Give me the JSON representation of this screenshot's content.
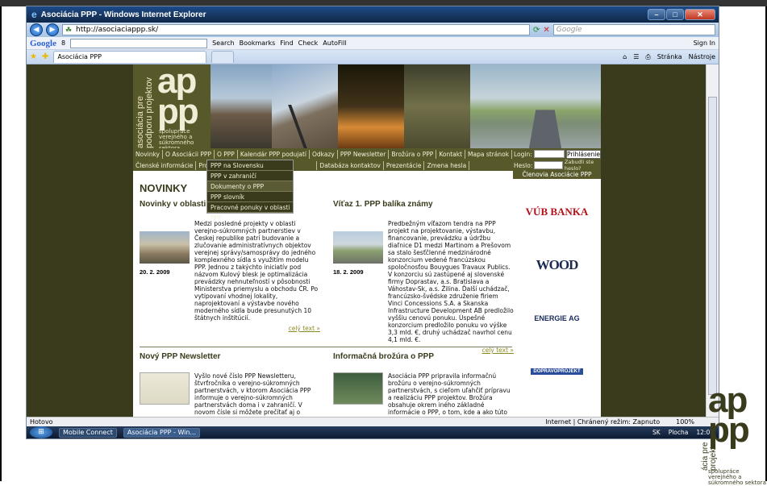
{
  "window": {
    "title": "Asociácia PPP - Windows Internet Explorer"
  },
  "address": {
    "url": "http://asociaciappp.sk/",
    "search_placeholder": "Google"
  },
  "googlebar": {
    "logo": "Google",
    "label": "8",
    "items": [
      "Search",
      "Bookmarks",
      "Find",
      "Check",
      "AutoFill",
      "Sign In"
    ]
  },
  "tabs": {
    "active": "Asociácia PPP"
  },
  "ie_tools": {
    "page": "Stránka",
    "tools": "Nástroje"
  },
  "logo": {
    "vertical": "asociácia pre podporu projektov",
    "big": "ap pp",
    "small": "spolupráce verejného a súkromného sektora"
  },
  "menu1": [
    "Novinky",
    "O Asociácii PPP",
    "O PPP",
    "Kalendár PPP podujatí",
    "Odkazy",
    "PPP Newsletter",
    "Brožúra o PPP",
    "Kontakt",
    "Mapa stránok"
  ],
  "menu2": [
    "Členské informácie",
    "Projekty",
    "Databáza kontaktov",
    "Prezentácie",
    "Zmena hesla"
  ],
  "dropdown": [
    "PPP na Slovensku",
    "PPP v zahraničí",
    "Dokumenty o PPP",
    "PPP slovník",
    "Pracovné ponuky v oblasti PPP"
  ],
  "login": {
    "login_label": "Login:",
    "password_label": "Heslo:",
    "button": "Prihlásenie",
    "forgot": "Zabudli ste heslo?"
  },
  "members_title": "Členovia Asociácie PPP",
  "heading": "NOVINKY",
  "article1": {
    "title": "Novinky v oblasti čes...",
    "date": "20. 2. 2009",
    "body": "Medzi posledné projekty v oblasti verejno-súkromných partnerstiev v Českej republike patrí budovanie a zlučovanie administratívnych objektov verejnej správy/samosprávy do jedného komplexného sídla s využitím modelu PPP. Jednou z takýchto iniciatív pod názvom Kulový blesk je optimalizácia prevádzky nehnuteľností v pôsobnosti Ministerstva priemyslu a obchodu ČR. Po vytipovaní vhodnej lokality, naprojektovaní a výstavbe nového moderného sídla bude presunutých 10 štátnych inštitúcií.",
    "more": "celý text »"
  },
  "article2": {
    "title": "Víťaz 1. PPP balíka známy",
    "date": "18. 2. 2009",
    "body": "Predbežným víťazom tendra na PPP projekt na projektovanie, výstavbu, financovanie, prevádzku a údržbu diaľnice D1 medzi Martinom a Prešovom sa stalo šesťčlenné medzinárodné konzorcium vedené francúzskou spoločnosťou Bouygues Travaux Publics. V konzorciu sú zastúpené aj slovenské firmy Doprastav, a.s. Bratislava a Váhostav-Sk, a.s. Žilina. Ďalší uchádzač, francúzsko-švédske združenie firiem Vinci Concessions S.A. a Skanska Infrastructure Development AB predložilo vyššiu cenovú ponuku. Úspešné konzorcium predložilo ponuku vo výške 3,3 mld. €, druhý uchádzač navrhol cenu 4,1 mld. €.",
    "more": "celý text »"
  },
  "article3": {
    "title": "Nový PPP Newsletter",
    "body": "Vyšlo nové číslo PPP Newsletteru, štvrťročníka o verejno-súkromných partnerstvách, v ktorom Asociácia PPP informuje o verejno-súkromných partnerstvách doma i v zahraničí. V novom čísle si môžete prečítať aj o"
  },
  "article4": {
    "title": "Informačná brožúra o PPP",
    "body": "Asociácia PPP pripravila informačnú brožúru o verejno-súkromných partnerstvách, s cieľom uľahčiť prípravu a realizáciu PPP projektov. Brožúra obsahuje okrem iného základné informácie o PPP, o tom, kde a ako túto"
  },
  "sponsors": [
    "VÚB BANKA",
    "WOOD",
    "ENERGIE AG",
    "DOPRAVOPROJEKT"
  ],
  "status": {
    "left": "Hotovo",
    "zone": "Internet | Chránený režim: Zapnuto",
    "zoom": "100%"
  },
  "taskbar": {
    "items": [
      "Mobile Connect",
      "Asociácia PPP - Win..."
    ],
    "lang": "SK",
    "desktop": "Plocha",
    "time": "12:07"
  },
  "corner_logo": {
    "big": "ap pp",
    "vertical": "ácia pre projektov",
    "small": "spolupráce verejného a súkromného sektora"
  }
}
